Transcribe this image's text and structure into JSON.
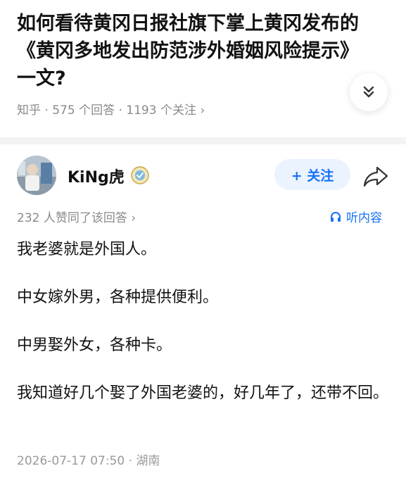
{
  "question": {
    "title": "如何看待黄冈日报社旗下掌上黄冈发布的《黄冈多地发出防范涉外婚姻风险提示》一文?",
    "meta": "知乎 · 575 个回答 · 1193 个关注 ›"
  },
  "answer": {
    "author_name": "KiNg虎",
    "follow_label": "+ 关注",
    "likes_text": "232 人赞同了该回答 ›",
    "listen_label": "听内容",
    "paragraphs": [
      "我老婆就是外国人。",
      "中女嫁外男，各种提供便利。",
      "中男娶外女，各种卡。",
      "我知道好几个娶了外国老婆的，好几年了，还带不回。"
    ],
    "timestamp": "2026-07-17 07:50 · 湖南"
  },
  "icons": {
    "expand": "double-chevron-down-icon",
    "share": "share-arrow-icon",
    "listen": "headphones-icon",
    "badge": "verified-badge-icon"
  },
  "colors": {
    "accent": "#1772f6",
    "follow_bg": "#ebf3ff",
    "muted_text": "#8a8a8a"
  }
}
